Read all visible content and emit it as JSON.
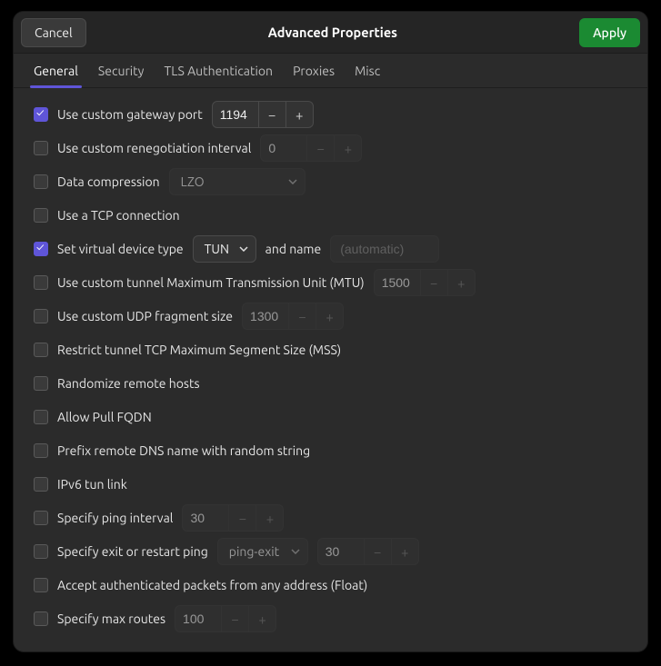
{
  "titlebar": {
    "cancel": "Cancel",
    "title": "Advanced Properties",
    "apply": "Apply"
  },
  "tabs": [
    {
      "label": "General",
      "active": true
    },
    {
      "label": "Security",
      "active": false
    },
    {
      "label": "TLS Authentication",
      "active": false
    },
    {
      "label": "Proxies",
      "active": false
    },
    {
      "label": "Misc",
      "active": false
    }
  ],
  "rows": {
    "gateway_port": {
      "label": "Use custom gateway port",
      "checked": true,
      "value": "1194"
    },
    "reneg": {
      "label": "Use custom renegotiation interval",
      "checked": false,
      "value": "0"
    },
    "compression": {
      "label": "Data compression",
      "checked": false,
      "select": "LZO"
    },
    "tcp": {
      "label": "Use a TCP connection",
      "checked": false
    },
    "vdev": {
      "label": "Set virtual device type",
      "checked": true,
      "select": "TUN",
      "mid": "and name",
      "placeholder": "(automatic)"
    },
    "mtu": {
      "label": "Use custom tunnel Maximum Transmission Unit (MTU)",
      "checked": false,
      "value": "1500"
    },
    "udpfrag": {
      "label": "Use custom UDP fragment size",
      "checked": false,
      "value": "1300"
    },
    "mss": {
      "label": "Restrict tunnel TCP Maximum Segment Size (MSS)",
      "checked": false
    },
    "randomize": {
      "label": "Randomize remote hosts",
      "checked": false
    },
    "pullfqdn": {
      "label": "Allow Pull FQDN",
      "checked": false
    },
    "prefixdns": {
      "label": "Prefix remote DNS name with random string",
      "checked": false
    },
    "ipv6tun": {
      "label": "IPv6 tun link",
      "checked": false
    },
    "ping": {
      "label": "Specify ping interval",
      "checked": false,
      "value": "30"
    },
    "pingexit": {
      "label": "Specify exit or restart ping",
      "checked": false,
      "select": "ping-exit",
      "value": "30"
    },
    "float": {
      "label": "Accept authenticated packets from any address (Float)",
      "checked": false
    },
    "maxroutes": {
      "label": "Specify max routes",
      "checked": false,
      "value": "100"
    }
  }
}
